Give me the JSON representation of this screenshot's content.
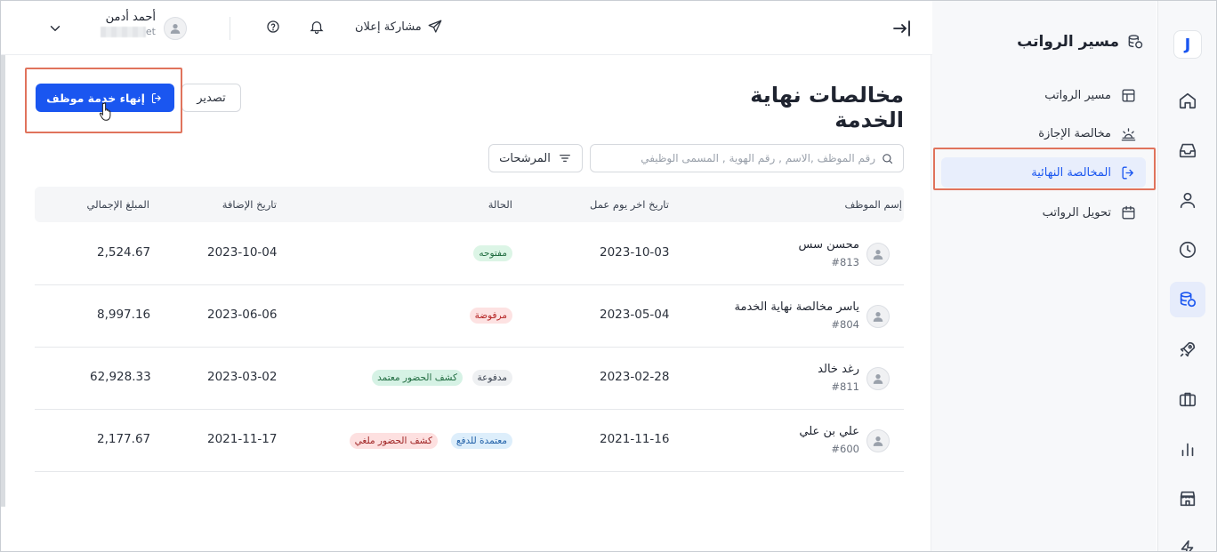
{
  "rail": {
    "logo": "J",
    "items": [
      "home-icon",
      "inbox-icon",
      "user-icon",
      "clock-icon",
      "coins-icon",
      "rocket-icon",
      "briefcase-icon",
      "chart-icon",
      "store-icon",
      "bolt-icon"
    ],
    "active_index": 4,
    "accent": "#1a56f0"
  },
  "sidenav": {
    "title": "مسير الرواتب",
    "items": [
      {
        "label": "مسير الرواتب",
        "icon": "table-icon"
      },
      {
        "label": "مخالصة الإجازة",
        "icon": "sunset-icon"
      },
      {
        "label": "المخالصة النهائية",
        "icon": "logout-icon",
        "active": true
      },
      {
        "label": "تحويل الرواتب",
        "icon": "calendar-icon"
      }
    ]
  },
  "topbar": {
    "share_label": "مشاركة إعلان",
    "user_name": "أحمد أدمن",
    "user_sub_suffix": "et"
  },
  "page": {
    "title": "مخالصات نهاية الخدمة",
    "primary_button": "إنهاء خدمة موظف",
    "export_button": "تصدير",
    "search_placeholder": "رقم الموظف ,الاسم , رقم الهوية , المسمى الوظيفي",
    "filters_button": "المرشحات"
  },
  "table": {
    "headers": {
      "employee": "إسم الموظف",
      "last_day": "تاريخ اخر يوم عمل",
      "status": "الحالة",
      "added": "تاريخ الإضافة",
      "total": "المبلغ الإجمالي"
    },
    "rows": [
      {
        "name": "محسن سس",
        "id": "#813",
        "last_day": "2023-10-03",
        "badges": [
          {
            "text": "مفتوحه",
            "kind": "green"
          }
        ],
        "added": "2023-10-04",
        "total": "2,524.67"
      },
      {
        "name": "ياسر مخالصة نهاية الخدمة",
        "id": "#804",
        "last_day": "2023-05-04",
        "badges": [
          {
            "text": "مرفوضة",
            "kind": "red"
          }
        ],
        "added": "2023-06-06",
        "total": "8,997.16"
      },
      {
        "name": "رغد خالد",
        "id": "#811",
        "last_day": "2023-02-28",
        "badges": [
          {
            "text": "مدفوعة",
            "kind": "gray"
          },
          {
            "text": "كشف الحضور معتمد",
            "kind": "teal"
          }
        ],
        "added": "2023-03-02",
        "total": "62,928.33"
      },
      {
        "name": "علي بن علي",
        "id": "#600",
        "last_day": "2021-11-16",
        "badges": [
          {
            "text": "معتمدة للدفع",
            "kind": "blue"
          },
          {
            "text": "كشف الحضور ملغي",
            "kind": "red2"
          }
        ],
        "added": "2021-11-17",
        "total": "2,177.67"
      }
    ]
  }
}
